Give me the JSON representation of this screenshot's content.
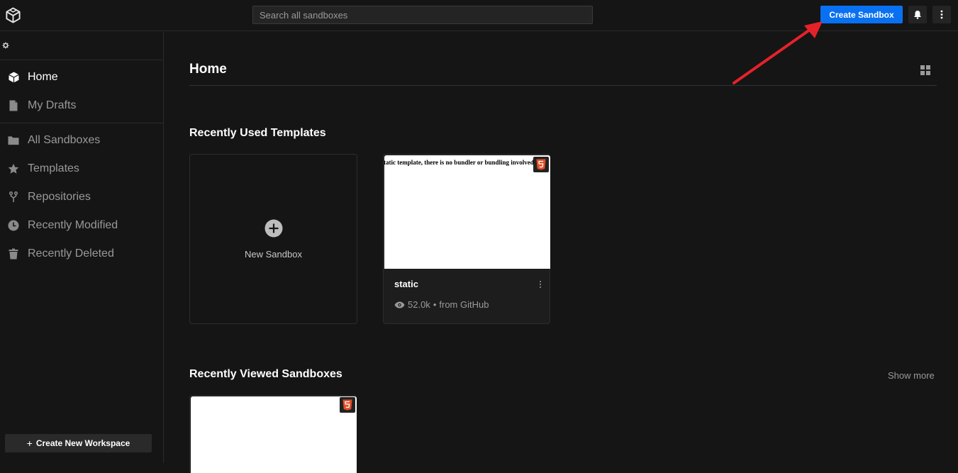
{
  "topbar": {
    "logo": "codesandbox-logo-icon",
    "search_placeholder": "Search all sandboxes",
    "create_label": "Create Sandbox",
    "bell": "bell-icon",
    "more": "kebab-icon"
  },
  "sidebar": {
    "items": [
      {
        "label": "Home",
        "icon": "cube-icon",
        "active": true
      },
      {
        "label": "My Drafts",
        "icon": "file-icon",
        "active": false
      },
      {
        "label": "All Sandboxes",
        "icon": "folder-icon",
        "active": false
      },
      {
        "label": "Templates",
        "icon": "star-icon",
        "active": false
      },
      {
        "label": "Repositories",
        "icon": "branch-icon",
        "active": false
      },
      {
        "label": "Recently Modified",
        "icon": "clock-icon",
        "active": false
      },
      {
        "label": "Recently Deleted",
        "icon": "trash-icon",
        "active": false
      }
    ],
    "workspace_plus": "+",
    "workspace_button": "Create New Workspace"
  },
  "main": {
    "title": "Home",
    "recent_templates_heading": "Recently Used Templates",
    "new_sandbox_label": "New Sandbox",
    "template": {
      "preview_text": "tatic template, there is no bundler or bundling involved!",
      "name": "static",
      "views": "52.0k",
      "separator": "•",
      "source": "from GitHub",
      "badge": "html5-icon"
    },
    "recent_viewed_heading": "Recently Viewed Sandboxes",
    "show_more": "Show more"
  },
  "colors": {
    "background": "#151515",
    "accent": "#0971f1",
    "annotation_arrow": "#e5222a",
    "html5_badge": "#e44d26"
  }
}
